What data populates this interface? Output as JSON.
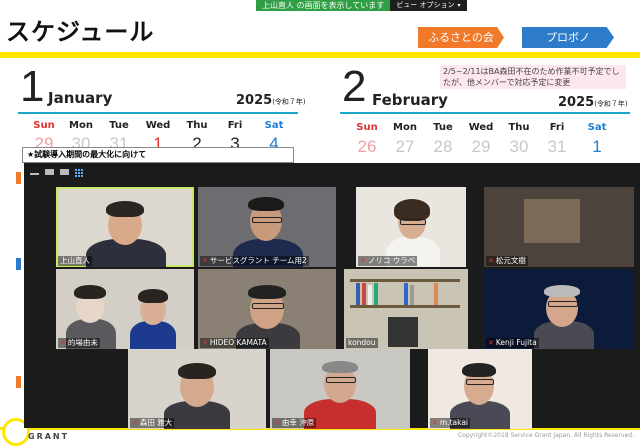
{
  "share": {
    "label": "上山直人 の画面を表示しています",
    "options": "ビュー オプション"
  },
  "slide": {
    "title": "スケジュール",
    "badges": [
      "ふるさとの会",
      "プロボノ"
    ],
    "notice": "2/5~2/11はBA森田不在のため作業不可予定でしたが、他メンバーで対応予定に変更",
    "trial_title": "★試験導入期間の最大化に向けて"
  },
  "cal1": {
    "num": "1",
    "month": "January",
    "year": "2025",
    "era": "(令和７年)",
    "dow": [
      "Sun",
      "Mon",
      "Tue",
      "Wed",
      "Thu",
      "Fri",
      "Sat"
    ],
    "row1": [
      "29",
      "30",
      "31",
      "1",
      "2",
      "3",
      "4"
    ]
  },
  "cal2": {
    "num": "2",
    "month": "February",
    "year": "2025",
    "era": "(令和７年)",
    "dow": [
      "Sun",
      "Mon",
      "Tue",
      "Wed",
      "Thu",
      "Fri",
      "Sat"
    ],
    "row1": [
      "26",
      "27",
      "28",
      "29",
      "30",
      "31",
      "1"
    ]
  },
  "participants": [
    {
      "name": "上山直人",
      "muted": false
    },
    {
      "name": "サービスグラント チーム用2",
      "muted": true
    },
    {
      "name": "ノリコ ウラベ",
      "muted": true
    },
    {
      "name": "松元文樹",
      "muted": true
    },
    {
      "name": "的場由未",
      "muted": true
    },
    {
      "name": "HIDEO KAMATA",
      "muted": true
    },
    {
      "name": "kondou",
      "muted": false
    },
    {
      "name": "Kenji Fujita",
      "muted": true
    },
    {
      "name": "森田 雅大",
      "muted": true
    },
    {
      "name": "由幸 沖原",
      "muted": true
    },
    {
      "name": "m.takai",
      "muted": true
    }
  ],
  "footer": {
    "brand": "GRANT",
    "copyright": "Copyright©2019 Service Grant Japan. All Rights Reserved."
  },
  "icons": {
    "mic_muted": "mic-muted-icon"
  }
}
